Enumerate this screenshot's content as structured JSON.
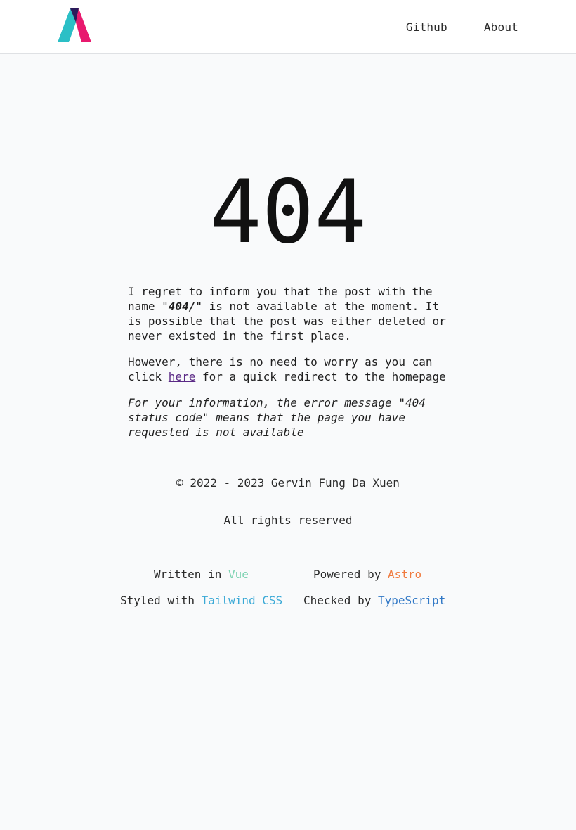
{
  "header": {
    "logo_alt": "Site logo",
    "nav": [
      {
        "label": "Github"
      },
      {
        "label": "About"
      }
    ]
  },
  "main": {
    "error_code": "404",
    "paragraph1": {
      "before": "I regret to inform you that the post with the name \"",
      "name": "404/",
      "after": "\" is not available at the moment. It is possible that the post was either deleted or never existed in the first place."
    },
    "paragraph2": {
      "before": "However, there is no need to worry as you can click ",
      "link": "here",
      "after": " for a quick redirect to the homepage"
    },
    "paragraph3": "For your information, the error message \"404 status code\" means that the page you have requested is not available"
  },
  "footer": {
    "copyright": "© 2022 - 2023 Gervin Fung Da Xuen",
    "rights": "All rights reserved",
    "written_label": "Written in ",
    "written_link": "Vue",
    "powered_label": "Powered by ",
    "powered_link": "Astro",
    "styled_label": "Styled with ",
    "styled_link": "Tailwind CSS",
    "checked_label": "Checked by ",
    "checked_link": "TypeScript"
  },
  "colors": {
    "logo_teal": "#2bbfc6",
    "logo_navy": "#2b1a5a",
    "logo_pink": "#e8196e",
    "vue": "#7ed3b2",
    "astro": "#f07b3f",
    "tailwind": "#3aa9d6",
    "typescript": "#3178c6"
  }
}
